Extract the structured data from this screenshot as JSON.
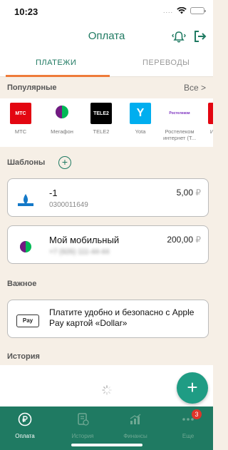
{
  "status_bar": {
    "time": "10:23"
  },
  "header": {
    "title": "Оплата",
    "bell_icon": "bell-icon",
    "exit_icon": "exit-icon"
  },
  "tabs": [
    {
      "label": "ПЛАТЕЖИ",
      "active": true
    },
    {
      "label": "ПЕРЕВОДЫ",
      "active": false
    }
  ],
  "popular": {
    "title": "Популярные",
    "all_label": "Все",
    "providers": [
      {
        "name": "МТС",
        "logo_color": "#e30611",
        "logo_text": "МТС"
      },
      {
        "name": "Мегафон",
        "logo_color": "#00b956",
        "logo_text": "МегаФон"
      },
      {
        "name": "TELE2",
        "logo_color": "#000000",
        "logo_text": "TELE2"
      },
      {
        "name": "Yota",
        "logo_color": "#00aeef",
        "logo_text": "Y"
      },
      {
        "name": "Ростелеком интернет (Т...",
        "logo_color": "#7b2fbf",
        "logo_text": "Ростелеком"
      },
      {
        "name": "Инт «Д",
        "logo_color": "#e30611",
        "logo_text": "Д"
      }
    ]
  },
  "templates": {
    "title": "Шаблоны",
    "items": [
      {
        "title": "-1",
        "subtitle": "0300011649",
        "amount": "5,00",
        "currency": "₽",
        "logo": "gazprom-logo"
      },
      {
        "title": "Мой мобильный",
        "subtitle": "+7 (926) 111-44-44",
        "amount": "200,00",
        "currency": "₽",
        "logo": "megafon-logo"
      }
    ]
  },
  "important": {
    "title": "Важное",
    "apple_pay_logo": "Pay",
    "text": "Платите удобно и безопасно с Apple Pay картой «Dollar»"
  },
  "history": {
    "title": "История"
  },
  "fab": {
    "label": "+"
  },
  "bottom_nav": [
    {
      "label": "Оплата",
      "active": true
    },
    {
      "label": "История",
      "active": false
    },
    {
      "label": "Финансы",
      "active": false
    },
    {
      "label": "Еще",
      "active": false,
      "badge": "3"
    }
  ],
  "colors": {
    "primary": "#1f7a62",
    "accent": "#ee7b3a",
    "background": "#f6efe6",
    "fab": "#1f9c84",
    "badge": "#e0342a"
  }
}
